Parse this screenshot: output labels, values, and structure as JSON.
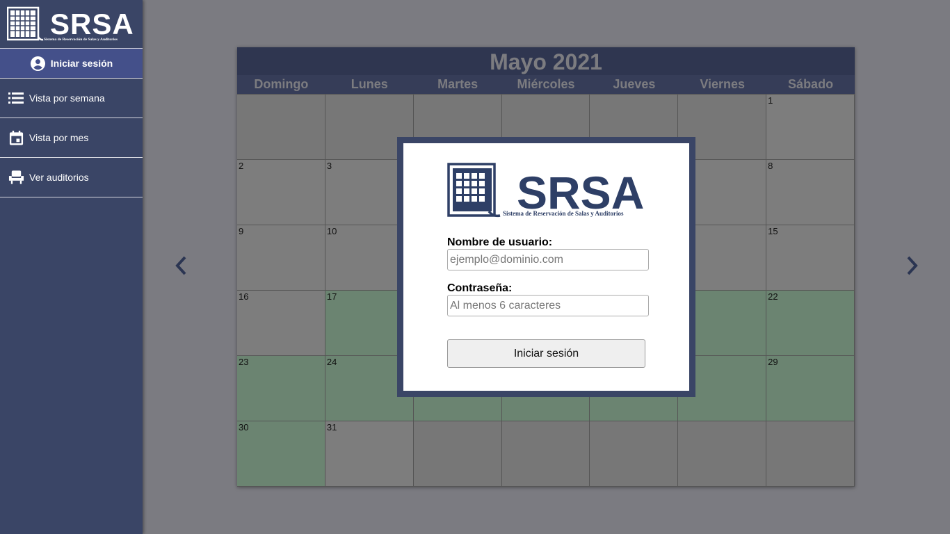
{
  "app": {
    "logo_text": "SRSA",
    "logo_subtitle": "Sistema de Reservación de Salas y Auditorios"
  },
  "sidebar": {
    "login_label": "Iniciar sesión",
    "items": [
      {
        "label": "Vista por semana",
        "icon": "list-icon"
      },
      {
        "label": "Vista por mes",
        "icon": "calendar-icon"
      },
      {
        "label": "Ver auditorios",
        "icon": "seat-icon"
      }
    ]
  },
  "calendar": {
    "title": "Mayo 2021",
    "weekdays": [
      "Domingo",
      "Lunes",
      "Martes",
      "Miércoles",
      "Jueves",
      "Viernes",
      "Sábado"
    ],
    "cells": [
      {
        "day": "",
        "state": "empty"
      },
      {
        "day": "",
        "state": "empty"
      },
      {
        "day": "",
        "state": "empty"
      },
      {
        "day": "",
        "state": "empty"
      },
      {
        "day": "",
        "state": "empty"
      },
      {
        "day": "",
        "state": "empty"
      },
      {
        "day": "1",
        "state": "gray"
      },
      {
        "day": "2",
        "state": "gray"
      },
      {
        "day": "3",
        "state": "gray"
      },
      {
        "day": "",
        "state": "gray"
      },
      {
        "day": "",
        "state": "gray"
      },
      {
        "day": "",
        "state": "gray"
      },
      {
        "day": "",
        "state": "gray"
      },
      {
        "day": "8",
        "state": "gray"
      },
      {
        "day": "9",
        "state": "gray"
      },
      {
        "day": "10",
        "state": "gray"
      },
      {
        "day": "",
        "state": "gray"
      },
      {
        "day": "",
        "state": "gray"
      },
      {
        "day": "",
        "state": "gray"
      },
      {
        "day": "",
        "state": "gray"
      },
      {
        "day": "15",
        "state": "gray"
      },
      {
        "day": "16",
        "state": "gray"
      },
      {
        "day": "17",
        "state": "green"
      },
      {
        "day": "",
        "state": "green"
      },
      {
        "day": "",
        "state": "green"
      },
      {
        "day": "",
        "state": "green"
      },
      {
        "day": "",
        "state": "green"
      },
      {
        "day": "22",
        "state": "green"
      },
      {
        "day": "23",
        "state": "green"
      },
      {
        "day": "24",
        "state": "green"
      },
      {
        "day": "",
        "state": "green"
      },
      {
        "day": "",
        "state": "green"
      },
      {
        "day": "",
        "state": "green"
      },
      {
        "day": "",
        "state": "green"
      },
      {
        "day": "29",
        "state": "green"
      },
      {
        "day": "30",
        "state": "green"
      },
      {
        "day": "31",
        "state": "gray"
      },
      {
        "day": "",
        "state": "empty"
      },
      {
        "day": "",
        "state": "empty"
      },
      {
        "day": "",
        "state": "empty"
      },
      {
        "day": "",
        "state": "empty"
      },
      {
        "day": "",
        "state": "empty"
      }
    ]
  },
  "login_modal": {
    "username_label": "Nombre de usuario:",
    "username_placeholder": "ejemplo@dominio.com",
    "password_label": "Contraseña:",
    "password_placeholder": "Al menos 6 caracteres",
    "submit_label": "Iniciar sesión"
  },
  "colors": {
    "sidebar": "#3a4566",
    "sidebar_active": "#44508a",
    "calendar_header": "#2f3650",
    "reserved_day": "#6b8471",
    "logo_blue": "#2e3f66"
  }
}
